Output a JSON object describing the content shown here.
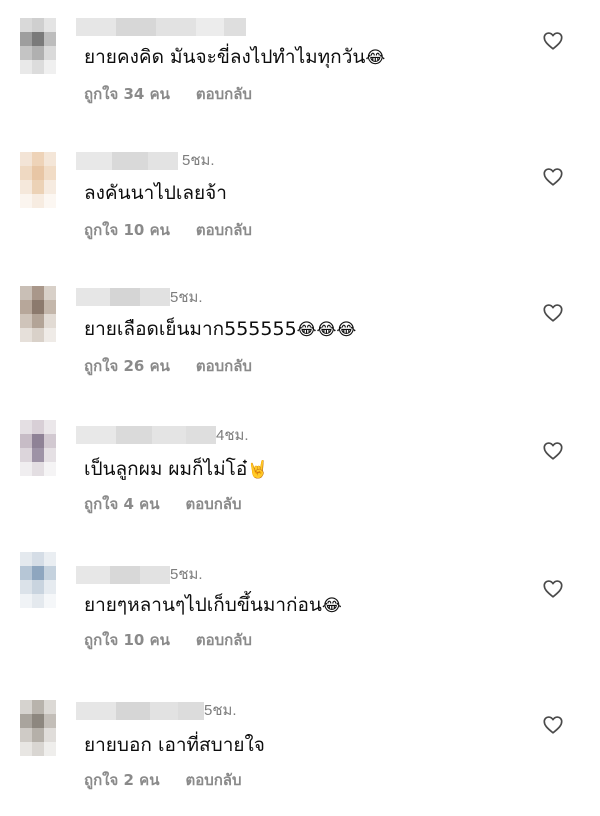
{
  "comments": [
    {
      "time": "",
      "text": "ยายคงคิด มันจะขี่ลงไปทำไมทุกวัน",
      "emoji": "😂",
      "likes": "ถูกใจ 34 คน",
      "reply": "ตอบกลับ"
    },
    {
      "time": "5ชม.",
      "text": "ลงคันนาไปเลยจ้า",
      "emoji": "",
      "likes": "ถูกใจ 10 คน",
      "reply": "ตอบกลับ"
    },
    {
      "time": "5ชม.",
      "text": "ยายเลือดเย็นมาก555555",
      "emoji": "😂😂😂",
      "likes": "ถูกใจ 26 คน",
      "reply": "ตอบกลับ"
    },
    {
      "time": "4ชม.",
      "text": "เป็นลูกผม ผมก็ไม่โอ๋",
      "emoji": "🤘",
      "likes": "ถูกใจ 4 คน",
      "reply": "ตอบกลับ"
    },
    {
      "time": "5ชม.",
      "text": "ยายๆหลานๆไปเก็บขึ้นมาก่อน",
      "emoji": "😂",
      "likes": "ถูกใจ 10 คน",
      "reply": "ตอบกลับ"
    },
    {
      "time": "5ชม.",
      "text": "ยายบอก เอาที่สบายใจ",
      "emoji": "",
      "likes": "ถูกใจ 2 คน",
      "reply": "ตอบกลับ"
    }
  ]
}
